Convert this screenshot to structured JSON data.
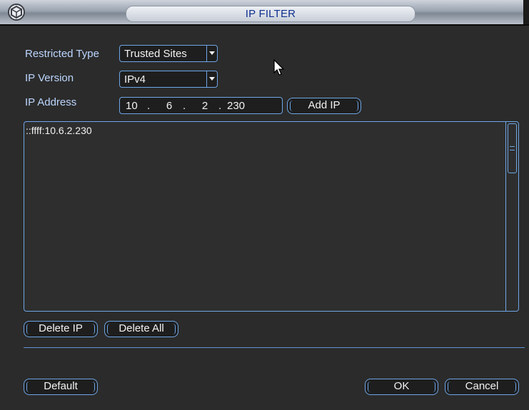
{
  "window": {
    "title": "IP FILTER"
  },
  "form": {
    "restricted_type_label": "Restricted Type",
    "restricted_type_value": "Trusted Sites",
    "ip_version_label": "IP Version",
    "ip_version_value": "IPv4",
    "ip_address_label": "IP Address",
    "ip_octets": [
      "10",
      "6",
      "2",
      "230"
    ],
    "add_ip_label": "Add IP"
  },
  "list": {
    "items": [
      "::ffff:10.6.2.230"
    ]
  },
  "actions": {
    "delete_ip_label": "Delete IP",
    "delete_all_label": "Delete All",
    "default_label": "Default",
    "ok_label": "OK",
    "cancel_label": "Cancel"
  },
  "colors": {
    "accent": "#6ea6e6",
    "background": "#2b2b2b",
    "title_text": "#0f2f8f"
  }
}
